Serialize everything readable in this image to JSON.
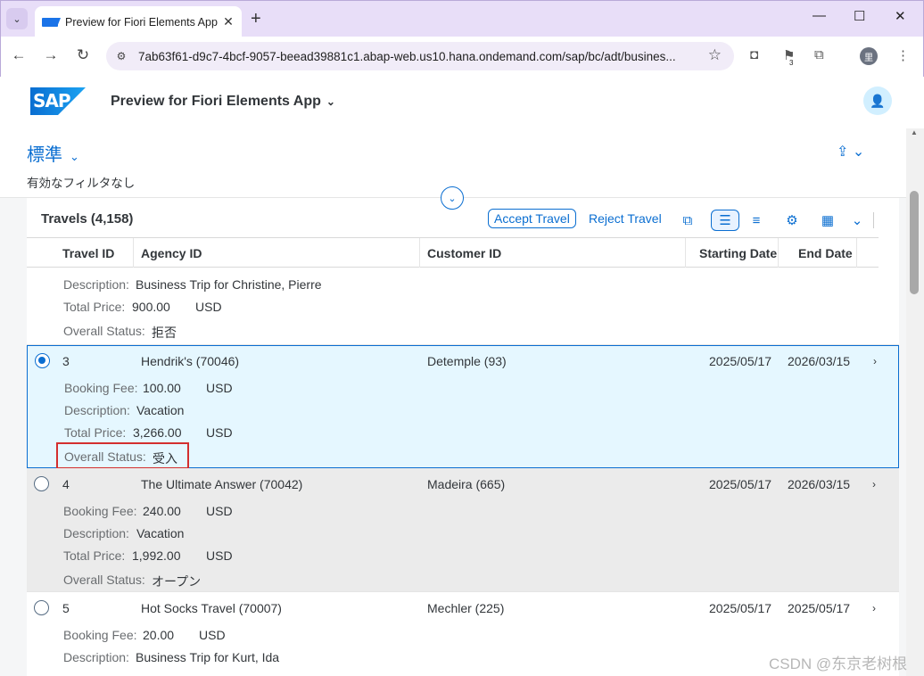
{
  "browser": {
    "tab_title": "Preview for Fiori Elements App",
    "url": "7ab63f61-d9c7-4bcf-9057-beead39881c1.abap-web.us10.hana.ondemand.com/sap/bc/adt/busines...",
    "profile_initial": "里",
    "flag_badge": "3"
  },
  "shell": {
    "logo": "SAP",
    "app_title": "Preview for Fiori Elements App"
  },
  "header": {
    "variant": "標準",
    "filter_summary": "有効なフィルタなし"
  },
  "table": {
    "title": "Travels (4,158)",
    "accept_label": "Accept Travel",
    "reject_label": "Reject Travel",
    "columns": [
      "Travel ID",
      "Agency ID",
      "Customer ID",
      "Starting Date",
      "End Date"
    ]
  },
  "labels": {
    "booking_fee": "Booking Fee:",
    "description": "Description:",
    "total_price": "Total Price:",
    "overall_status": "Overall Status:"
  },
  "rows": [
    {
      "description": "Business Trip for Christine, Pierre",
      "total_price": "900.00",
      "currency": "USD",
      "status": "拒否"
    },
    {
      "travel_id": "3",
      "agency": "Hendrik's (70046)",
      "customer": "Detemple (93)",
      "start": "2025/05/17",
      "end": "2026/03/15",
      "booking_fee": "100.00",
      "currency": "USD",
      "description": "Vacation",
      "total_price": "3,266.00",
      "status": "受入"
    },
    {
      "travel_id": "4",
      "agency": "The Ultimate Answer (70042)",
      "customer": "Madeira (665)",
      "start": "2025/05/17",
      "end": "2026/03/15",
      "booking_fee": "240.00",
      "currency": "USD",
      "description": "Vacation",
      "total_price": "1,992.00",
      "status": "オープン"
    },
    {
      "travel_id": "5",
      "agency": "Hot Socks Travel (70007)",
      "customer": "Mechler (225)",
      "start": "2025/05/17",
      "end": "2025/05/17",
      "booking_fee": "20.00",
      "currency": "USD",
      "description": "Business Trip for Kurt, Ida"
    }
  ],
  "watermark": "CSDN @东京老树根",
  "colors": {
    "accent": "#0a6ed1",
    "selected_row": "#e5f7ff",
    "grey_row": "#ebebeb",
    "highlight": "#d32f2f"
  }
}
